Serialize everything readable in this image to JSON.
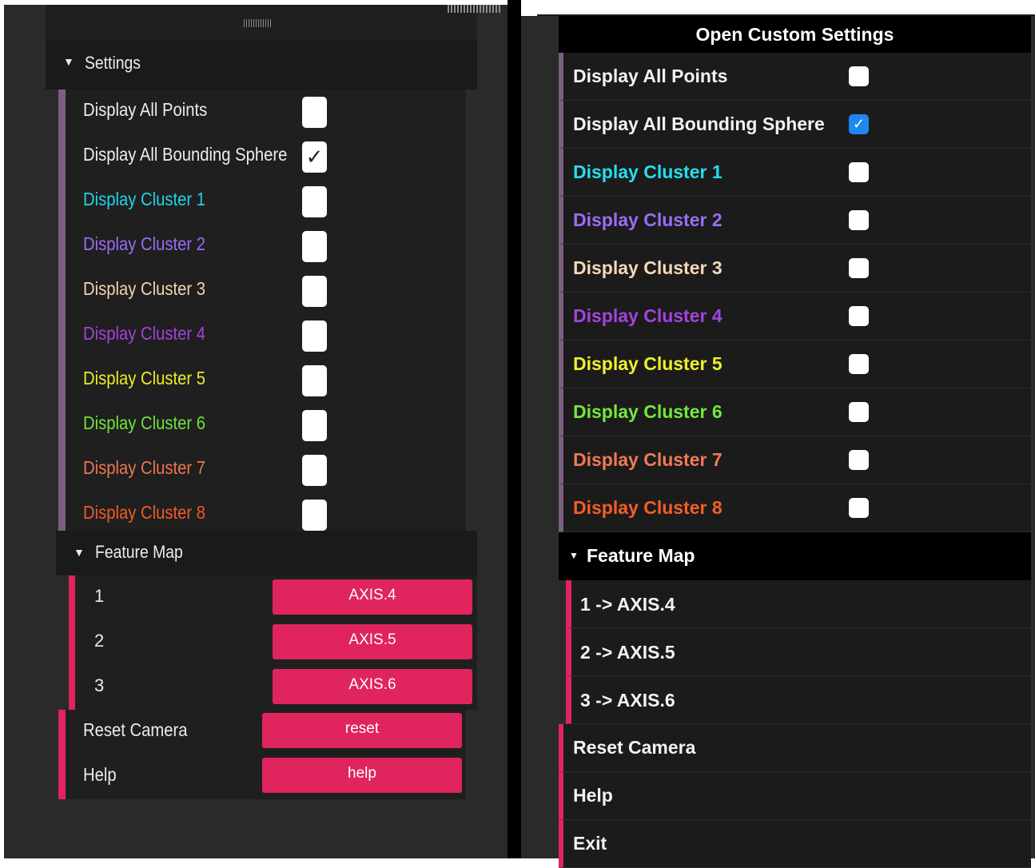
{
  "colors": {
    "accent": "#e0245e",
    "folder_bar": "#7a5f80",
    "checkbox_checked": "#1e88f0"
  },
  "left_panel": {
    "settings_title": "Settings",
    "settings_rows": [
      {
        "label": "Display All Points",
        "color": "#ececec",
        "checked": false
      },
      {
        "label": "Display All Bounding Sphere",
        "color": "#ececec",
        "checked": true
      },
      {
        "label": "Display Cluster 1",
        "color": "#22d3e6",
        "checked": false
      },
      {
        "label": "Display Cluster 2",
        "color": "#9b6bf5",
        "checked": false
      },
      {
        "label": "Display Cluster 3",
        "color": "#f4d2b0",
        "checked": false
      },
      {
        "label": "Display Cluster 4",
        "color": "#a441dc",
        "checked": false
      },
      {
        "label": "Display Cluster 5",
        "color": "#ecec27",
        "checked": false
      },
      {
        "label": "Display Cluster 6",
        "color": "#6fe33a",
        "checked": false
      },
      {
        "label": "Display Cluster 7",
        "color": "#ef7550",
        "checked": false
      },
      {
        "label": "Display Cluster 8",
        "color": "#f05a24",
        "checked": false
      }
    ],
    "feature_map_title": "Feature Map",
    "feature_map": [
      {
        "num": "1",
        "button": "AXIS.4"
      },
      {
        "num": "2",
        "button": "AXIS.5"
      },
      {
        "num": "3",
        "button": "AXIS.6"
      }
    ],
    "reset_label": "Reset Camera",
    "reset_button": "reset",
    "help_label": "Help",
    "help_button": "help"
  },
  "right_panel": {
    "title": "Open Custom Settings",
    "settings_rows": [
      {
        "label": "Display All Points",
        "color": "#f2f2f2",
        "checked": false
      },
      {
        "label": "Display All Bounding Sphere",
        "color": "#f2f2f2",
        "checked": true
      },
      {
        "label": "Display Cluster 1",
        "color": "#22e0f0",
        "checked": false
      },
      {
        "label": "Display Cluster 2",
        "color": "#9d6cf7",
        "checked": false
      },
      {
        "label": "Display Cluster 3",
        "color": "#f6d7b8",
        "checked": false
      },
      {
        "label": "Display Cluster 4",
        "color": "#a443de",
        "checked": false
      },
      {
        "label": "Display Cluster 5",
        "color": "#f0f02a",
        "checked": false
      },
      {
        "label": "Display Cluster 6",
        "color": "#74e83d",
        "checked": false
      },
      {
        "label": "Display Cluster 7",
        "color": "#f27a54",
        "checked": false
      },
      {
        "label": "Display Cluster 8",
        "color": "#f45e26",
        "checked": false
      }
    ],
    "feature_map_title": "Feature Map",
    "feature_map": [
      "1 -> AXIS.4",
      "2 -> AXIS.5",
      "3 -> AXIS.6"
    ],
    "reset_label": "Reset Camera",
    "help_label": "Help",
    "exit_label": "Exit"
  }
}
